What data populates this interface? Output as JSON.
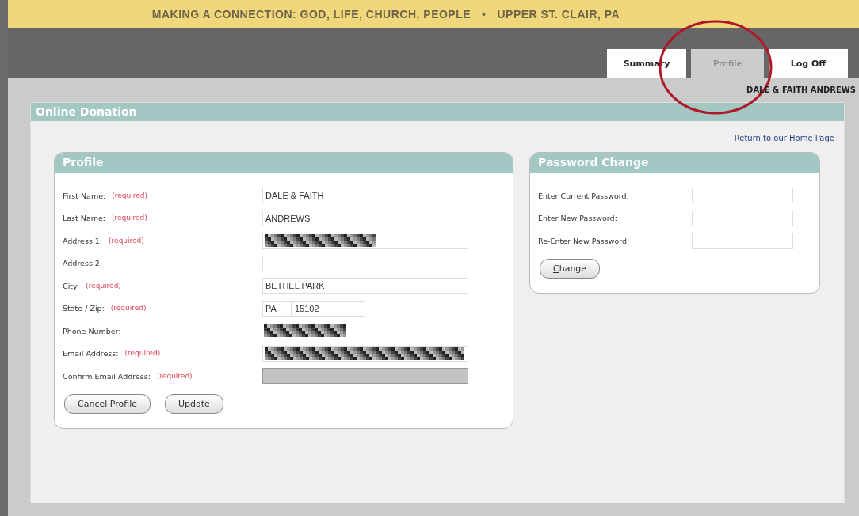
{
  "banner": {
    "title": "MAKING A CONNECTION: GOD, LIFE, CHURCH, PEOPLE",
    "separator": "•",
    "location": "UPPER ST. CLAIR, PA"
  },
  "tabs": [
    {
      "label": "Summary",
      "selected": false
    },
    {
      "label": "Profile",
      "selected": true
    },
    {
      "label": "Log Off",
      "selected": false
    }
  ],
  "user_name": "DALE & FAITH ANDREWS",
  "panel": {
    "title": "Online Donation",
    "home_link": "Return to our Home Page"
  },
  "profile": {
    "title": "Profile",
    "fields": [
      {
        "label": "First Name:",
        "note": "(required)",
        "kind": "text",
        "value": "DALE & FAITH"
      },
      {
        "label": "Last Name:",
        "note": "(required)",
        "kind": "text",
        "value": "ANDREWS"
      },
      {
        "label": "Address 1:",
        "note": "(required)",
        "kind": "redacted"
      },
      {
        "label": "Address 2:",
        "kind": "text"
      },
      {
        "label": "City:",
        "note": "(required)",
        "kind": "text",
        "value": "BETHEL PARK"
      },
      {
        "label": "State / Zip:",
        "note": "(required)",
        "kind": "state_zip",
        "state": "PA",
        "zip": "15102"
      },
      {
        "label": "Phone Number:",
        "kind": "redacted_short"
      },
      {
        "label": "Email Address:",
        "note": "(required)",
        "kind": "redacted"
      },
      {
        "label": "Confirm Email Address:",
        "note": "(required)",
        "kind": "disabled"
      }
    ],
    "buttons": [
      "Cancel Profile",
      "Update"
    ]
  },
  "password": {
    "title": "Password Change",
    "fields": [
      {
        "label": "Enter Current Password:"
      },
      {
        "label": "Enter New Password:"
      },
      {
        "label": "Re-Enter New Password:"
      }
    ],
    "button": "Change"
  },
  "annotation": {
    "kind": "circle",
    "color": "#b0182a"
  }
}
